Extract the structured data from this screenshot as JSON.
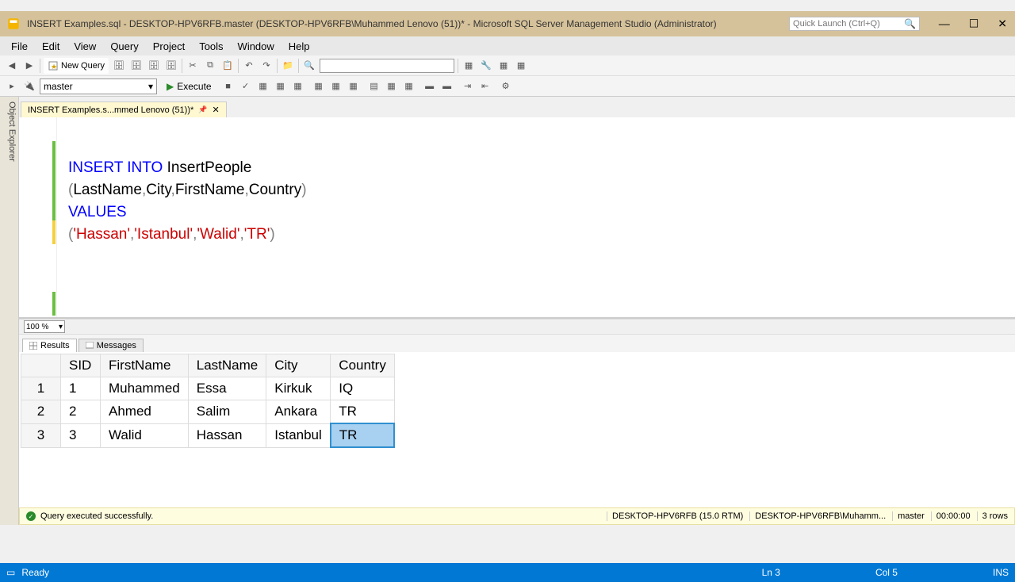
{
  "titlebar": {
    "text": "INSERT Examples.sql - DESKTOP-HPV6RFB.master (DESKTOP-HPV6RFB\\Muhammed Lenovo (51))* - Microsoft SQL Server Management Studio (Administrator)",
    "quick_launch_placeholder": "Quick Launch (Ctrl+Q)"
  },
  "menu": [
    "File",
    "Edit",
    "View",
    "Query",
    "Project",
    "Tools",
    "Window",
    "Help"
  ],
  "toolbar": {
    "new_query": "New Query",
    "db": "master",
    "execute": "Execute"
  },
  "tab": {
    "label": "INSERT Examples.s...mmed Lenovo (51))*"
  },
  "obj_explorer_label": "Object Explorer",
  "editor": {
    "line1_kw": "INSERT INTO",
    "line1_tbl": " InsertPeople",
    "line2": "(LastName,City,FirstName,Country)",
    "line3_kw": "VALUES",
    "line4": "('Hassan','Istanbul','Walid','TR')"
  },
  "zoom": "100 %",
  "rtabs": {
    "results": "Results",
    "messages": "Messages"
  },
  "grid": {
    "headers": [
      "SID",
      "FirstName",
      "LastName",
      "City",
      "Country"
    ],
    "rows": [
      [
        "1",
        "Muhammed",
        "Essa",
        "Kirkuk",
        "IQ"
      ],
      [
        "2",
        "Ahmed",
        "Salim",
        "Ankara",
        "TR"
      ],
      [
        "3",
        "Walid",
        "Hassan",
        "Istanbul",
        "TR"
      ]
    ]
  },
  "status_results": {
    "msg": "Query executed successfully.",
    "server": "DESKTOP-HPV6RFB (15.0 RTM)",
    "user": "DESKTOP-HPV6RFB\\Muhamm...",
    "db": "master",
    "time": "00:00:00",
    "rows": "3 rows"
  },
  "statusbar": {
    "ready": "Ready",
    "ln": "Ln 3",
    "col": "Col 5",
    "ins": "INS"
  }
}
